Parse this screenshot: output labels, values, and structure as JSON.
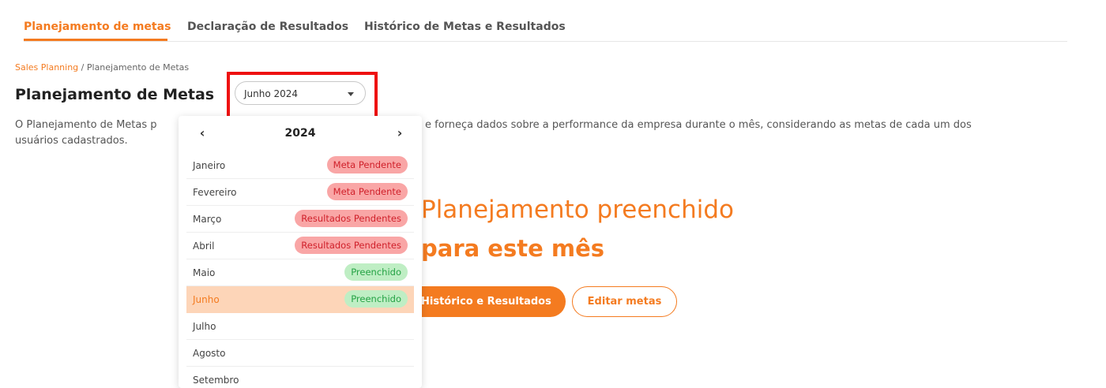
{
  "tabs": [
    {
      "label": "Planejamento de metas",
      "active": true
    },
    {
      "label": "Declaração de Resultados",
      "active": false
    },
    {
      "label": "Histórico de Metas e Resultados",
      "active": false
    }
  ],
  "breadcrumb": {
    "link": "Sales Planning",
    "separator": " / ",
    "current": "Planejamento de Metas"
  },
  "page_title": "Planejamento de Metas",
  "month_select": {
    "value": "Junho 2024"
  },
  "description": {
    "line1_start": "O Planejamento de Metas p",
    "line1_end": "e forneça dados sobre a performance da empresa durante o mês, considerando as metas de cada um dos",
    "line2": "usuários cadastrados."
  },
  "hero": {
    "title": "Planejamento preenchido",
    "subtitle": "para este mês"
  },
  "buttons": {
    "historico": "Histórico e Resultados",
    "editar": "Editar metas"
  },
  "dropdown": {
    "year": "2024",
    "prev_icon": "‹",
    "next_icon": "›",
    "months": [
      {
        "name": "Janeiro",
        "status": "Meta Pendente",
        "status_type": "pending"
      },
      {
        "name": "Fevereiro",
        "status": "Meta Pendente",
        "status_type": "pending"
      },
      {
        "name": "Março",
        "status": "Resultados Pendentes",
        "status_type": "pending"
      },
      {
        "name": "Abril",
        "status": "Resultados Pendentes",
        "status_type": "pending"
      },
      {
        "name": "Maio",
        "status": "Preenchido",
        "status_type": "done"
      },
      {
        "name": "Junho",
        "status": "Preenchido",
        "status_type": "done",
        "selected": true
      },
      {
        "name": "Julho"
      },
      {
        "name": "Agosto"
      },
      {
        "name": "Setembro"
      }
    ]
  },
  "colors": {
    "accent": "#f47b20",
    "pending_bg": "#f9a6a6",
    "pending_text": "#d0202a",
    "done_bg": "#bfeec4",
    "done_text": "#24a244",
    "selected_row": "#fdd5b8",
    "highlight": "#ee1111"
  }
}
